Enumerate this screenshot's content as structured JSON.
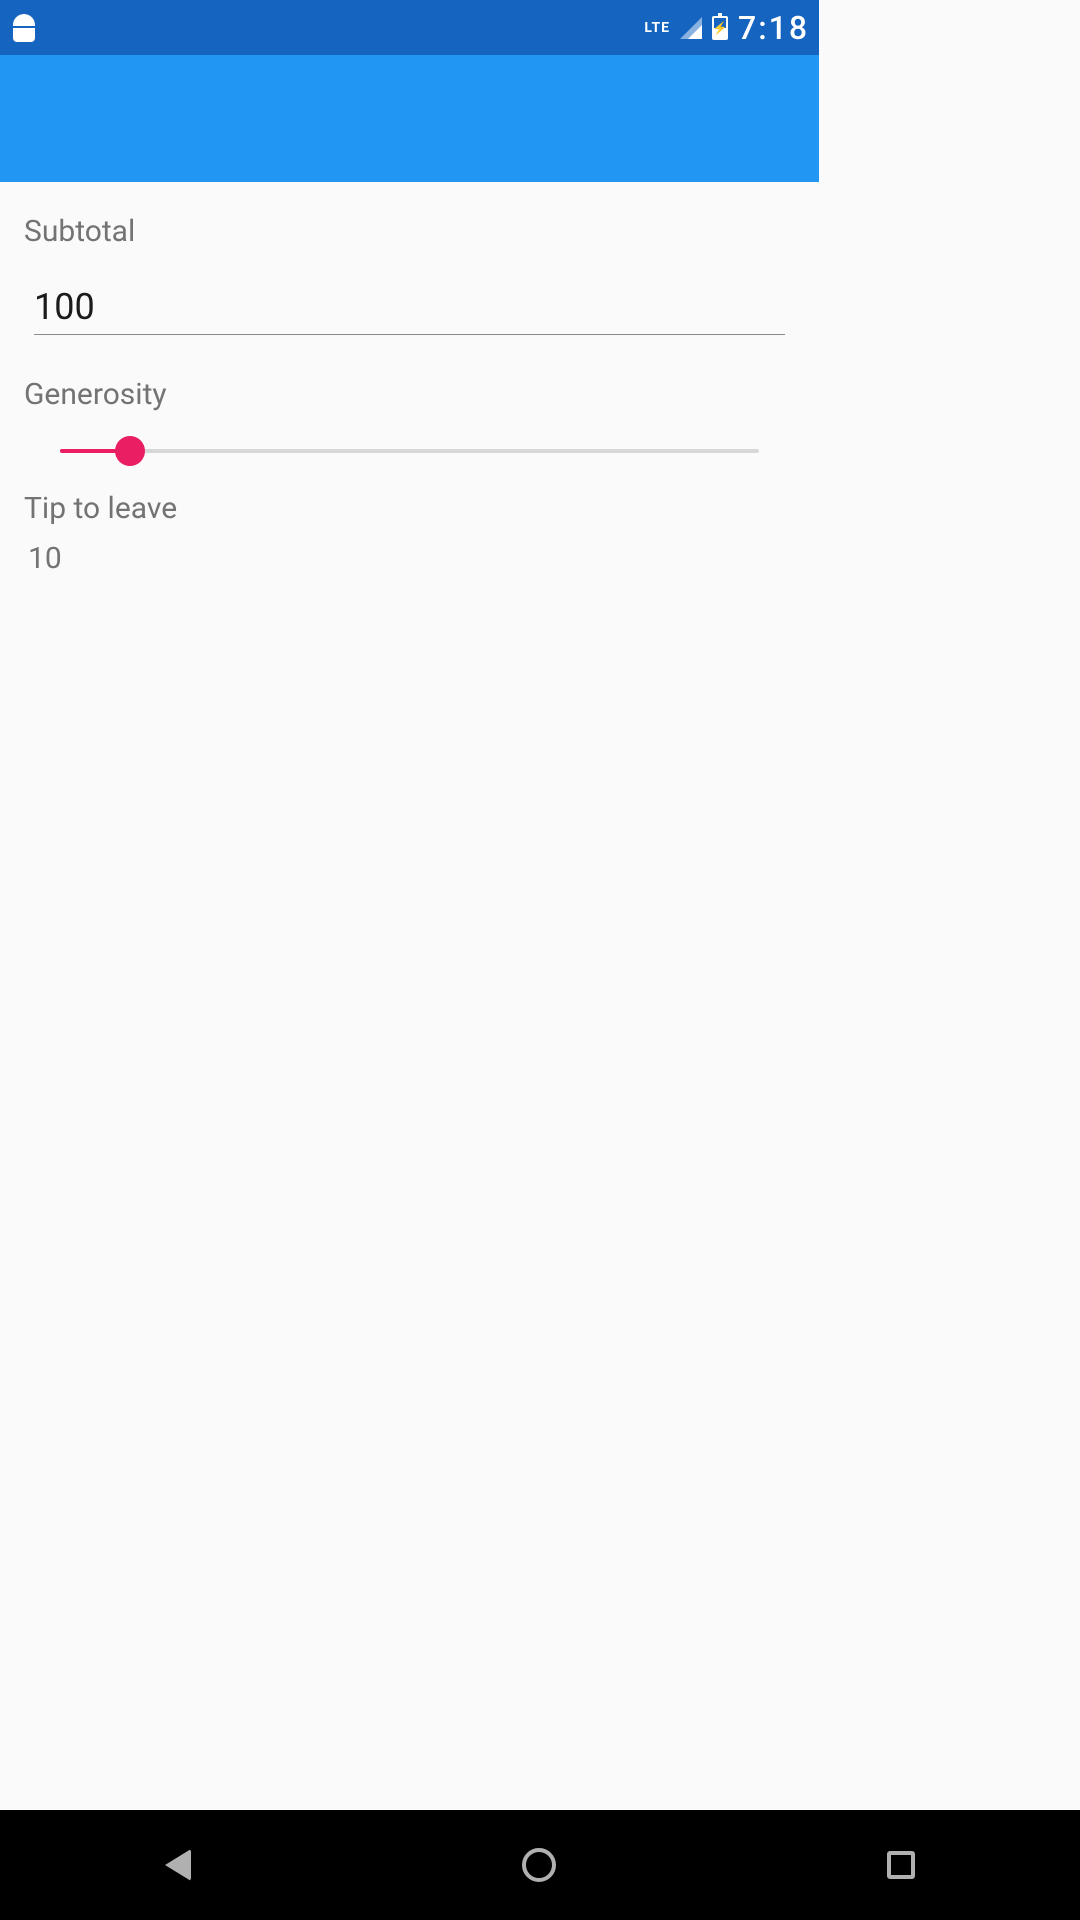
{
  "status": {
    "network_label": "LTE",
    "clock": "7:18"
  },
  "labels": {
    "subtotal": "Subtotal",
    "generosity": "Generosity",
    "tip_to_leave": "Tip to leave"
  },
  "subtotal": {
    "value": "100"
  },
  "generosity": {
    "value": 10,
    "min": 0,
    "max": 100
  },
  "tip": {
    "value": "10"
  },
  "colors": {
    "primary": "#2196f3",
    "primary_dark": "#1565c0",
    "accent": "#e91e63"
  }
}
